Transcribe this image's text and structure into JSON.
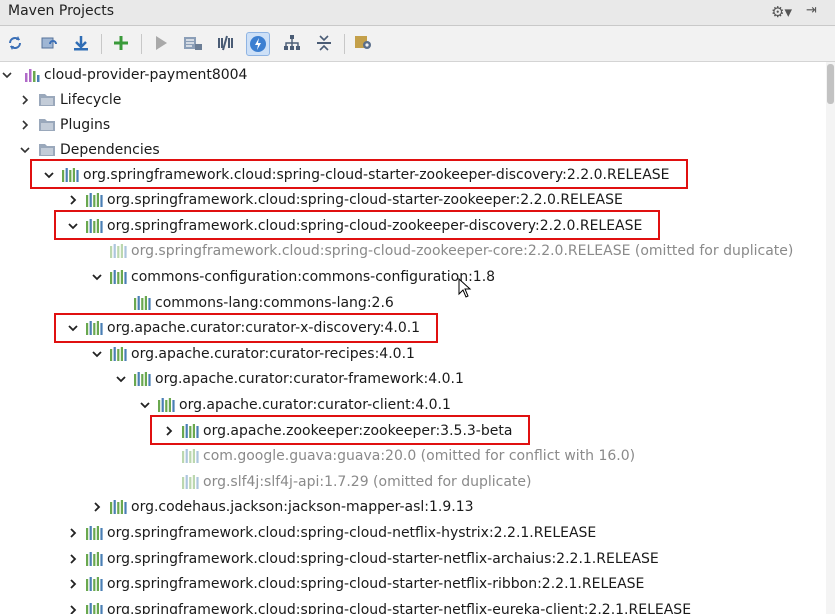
{
  "window": {
    "title": "Maven Projects"
  },
  "toolbar": {
    "buttons": [
      {
        "icon": "reimport-icon"
      },
      {
        "icon": "generate-sources-icon"
      },
      {
        "icon": "download-icon"
      },
      {
        "icon": "add-icon"
      },
      {
        "icon": "run-icon"
      },
      {
        "icon": "execute-goal-icon"
      },
      {
        "icon": "toggle-offline-icon"
      },
      {
        "icon": "skip-tests-icon",
        "active": true
      },
      {
        "icon": "show-dependencies-icon"
      },
      {
        "icon": "collapse-all-icon"
      },
      {
        "icon": "settings-icon"
      }
    ]
  },
  "tree": {
    "root": {
      "label": "cloud-provider-payment8004"
    },
    "lifecycle": "Lifecycle",
    "plugins": "Plugins",
    "dependencies": "Dependencies",
    "deps": [
      {
        "label": "org.springframework.cloud:spring-cloud-starter-zookeeper-discovery:2.2.0.RELEASE",
        "level": 0,
        "state": "expanded",
        "highlighted": true
      },
      {
        "label": "org.springframework.cloud:spring-cloud-starter-zookeeper:2.2.0.RELEASE",
        "level": 1,
        "state": "collapsed"
      },
      {
        "label": "org.springframework.cloud:spring-cloud-zookeeper-discovery:2.2.0.RELEASE",
        "level": 1,
        "state": "expanded",
        "highlighted": true
      },
      {
        "label": "org.springframework.cloud:spring-cloud-zookeeper-core:2.2.0.RELEASE (omitted for duplicate)",
        "level": 2,
        "state": "leaf",
        "dim": true
      },
      {
        "label": "commons-configuration:commons-configuration:1.8",
        "level": 2,
        "state": "expanded"
      },
      {
        "label": "commons-lang:commons-lang:2.6",
        "level": 3,
        "state": "leaf"
      },
      {
        "label": "org.apache.curator:curator-x-discovery:4.0.1",
        "level": 1,
        "state": "expanded",
        "highlighted": true
      },
      {
        "label": "org.apache.curator:curator-recipes:4.0.1",
        "level": 2,
        "state": "expanded"
      },
      {
        "label": "org.apache.curator:curator-framework:4.0.1",
        "level": 3,
        "state": "expanded"
      },
      {
        "label": "org.apache.curator:curator-client:4.0.1",
        "level": 4,
        "state": "expanded"
      },
      {
        "label": "org.apache.zookeeper:zookeeper:3.5.3-beta",
        "level": 5,
        "state": "collapsed",
        "highlighted": true
      },
      {
        "label": "com.google.guava:guava:20.0 (omitted for conflict with 16.0)",
        "level": 5,
        "state": "leaf",
        "dim": true
      },
      {
        "label": "org.slf4j:slf4j-api:1.7.29 (omitted for duplicate)",
        "level": 5,
        "state": "leaf",
        "dim": true
      },
      {
        "label": "org.codehaus.jackson:jackson-mapper-asl:1.9.13",
        "level": 2,
        "state": "collapsed"
      },
      {
        "label": "org.springframework.cloud:spring-cloud-netflix-hystrix:2.2.1.RELEASE",
        "level": 1,
        "state": "collapsed"
      },
      {
        "label": "org.springframework.cloud:spring-cloud-starter-netflix-archaius:2.2.1.RELEASE",
        "level": 1,
        "state": "collapsed"
      },
      {
        "label": "org.springframework.cloud:spring-cloud-starter-netflix-ribbon:2.2.1.RELEASE",
        "level": 1,
        "state": "collapsed"
      },
      {
        "label": "org.springframework.cloud:spring-cloud-starter-netflix-eureka-client:2.2.1.RELEASE",
        "level": 1,
        "state": "collapsed"
      }
    ]
  },
  "colors": {
    "highlight": "#e01010",
    "lib_green": "#6aa84f",
    "lib_blue": "#4a7fb5"
  }
}
